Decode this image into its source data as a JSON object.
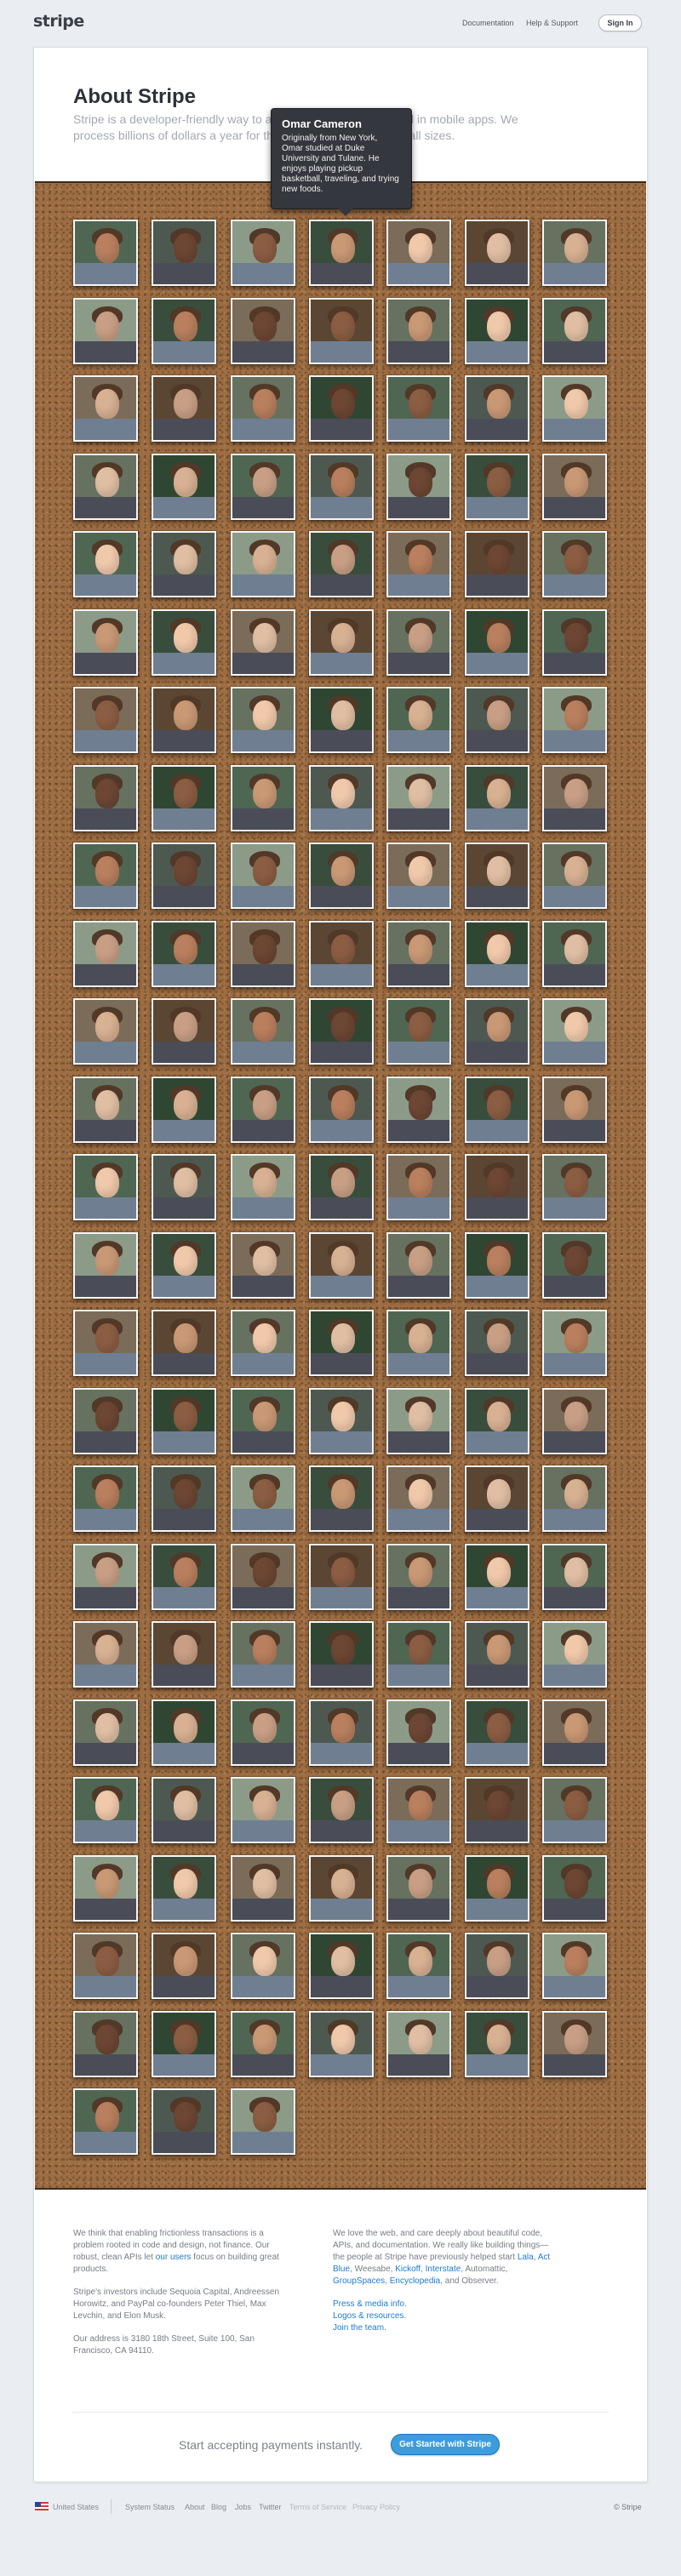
{
  "header": {
    "logo": "stripe",
    "nav": [
      {
        "label": "Documentation"
      },
      {
        "label": "Help & Support"
      }
    ],
    "signin_label": "Sign In"
  },
  "about": {
    "title": "About Stripe",
    "intro_visible": "Stripe is a developer-friendly way to accept payments online and in mobile apps. We process billions of dollars a year for thousands of companies of all sizes."
  },
  "tooltip": {
    "name": "Omar Cameron",
    "bio": "Originally from New York, Omar studied at Duke University and Tulane. He enjoys playing pickup basketball, traveling, and trying new foods."
  },
  "team_grid": {
    "columns": 7,
    "rows": 25,
    "count": 171
  },
  "footer": {
    "left_paragraphs": [
      "We think that enabling frictionless transactions is a problem rooted in code and design, not finance. Our robust, clean APIs let our users focus on building great products.",
      "Stripe's investors include Sequoia Capital, Andreessen Horowitz, and PayPal co-founders Peter Thiel, Max Levchin, and Elon Musk.",
      "Our address is 3180 18th Street, Suite 100, San Francisco, CA 94110."
    ],
    "right_paragraphs": [
      "We love the web, and care deeply about beautiful code, APIs, and documentation. We really like building things—the people at Stripe have previously helped start Lala, Act Blue, Weesabe, Kickoff, Interstate, Automattic, GroupSpaces, Encyclopedia, and Observer."
    ],
    "right_links": [
      {
        "label": "Press & media info."
      },
      {
        "label": "Logos & resources."
      },
      {
        "label": "Join the team."
      }
    ],
    "cta_text": "Start accepting payments instantly.",
    "cta_button": "Get Started with Stripe"
  },
  "bottom_bar": {
    "country": "United States",
    "links": [
      "System Status",
      "About",
      "Blog",
      "Jobs",
      "Twitter",
      "Terms of Service",
      "Privacy Policy"
    ],
    "copyright": "© Stripe"
  },
  "colors": {
    "background": "#eaeef2",
    "cork": "#9d6d43",
    "brand_blue": "#3c9ddc",
    "tooltip_background": "#34373d"
  },
  "icons": [
    "united-states-flag-icon"
  ]
}
